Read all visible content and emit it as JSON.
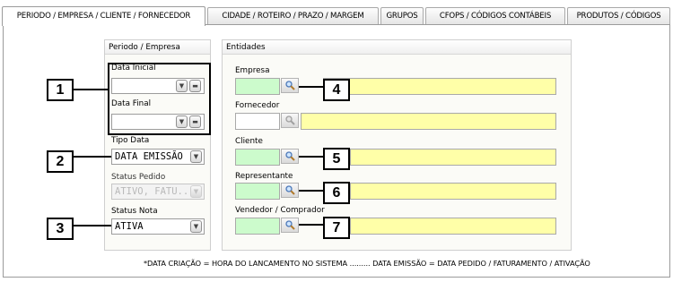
{
  "tabs": [
    {
      "label": "PERIODO / EMPRESA / CLIENTE / FORNECEDOR",
      "active": true
    },
    {
      "label": "CIDADE / ROTEIRO / PRAZO / MARGEM",
      "active": false
    },
    {
      "label": "GRUPOS",
      "active": false
    },
    {
      "label": "CFOPS / CÓDIGOS CONTÁBEIS",
      "active": false
    },
    {
      "label": "PRODUTOS / CÓDIGOS",
      "active": false
    }
  ],
  "periodo": {
    "title": "Periodo / Empresa",
    "data_inicial_label": "Data Inicial",
    "data_inicial_value": "",
    "data_final_label": "Data Final",
    "data_final_value": "",
    "tipo_data_label": "Tipo Data",
    "tipo_data_value": "DATA EMISSÃO",
    "status_pedido_label": "Status Pedido",
    "status_pedido_value": "ATIVO, FATU...",
    "status_nota_label": "Status Nota",
    "status_nota_value": "ATIVA"
  },
  "entidades": {
    "title": "Entidades",
    "empresa_label": "Empresa",
    "fornecedor_label": "Fornecedor",
    "cliente_label": "Cliente",
    "representante_label": "Representante",
    "vendedor_label": "Vendedor / Comprador"
  },
  "callouts": [
    "1",
    "2",
    "3",
    "4",
    "5",
    "6",
    "7"
  ],
  "footnote": "*DATA CRIAÇÃO = HORA DO LANCAMENTO NO SISTEMA ......... DATA EMISSÃO = DATA PEDIDO / FATURAMENTO / ATIVAÇÃO",
  "icons": {
    "dropdown": "chevron-down-icon",
    "clear": "minus-icon",
    "search": "magnifier-icon"
  },
  "colors": {
    "code_field": "#ccfbcc",
    "name_field": "#ffffa8",
    "group_bg": "#fbfbf7"
  }
}
